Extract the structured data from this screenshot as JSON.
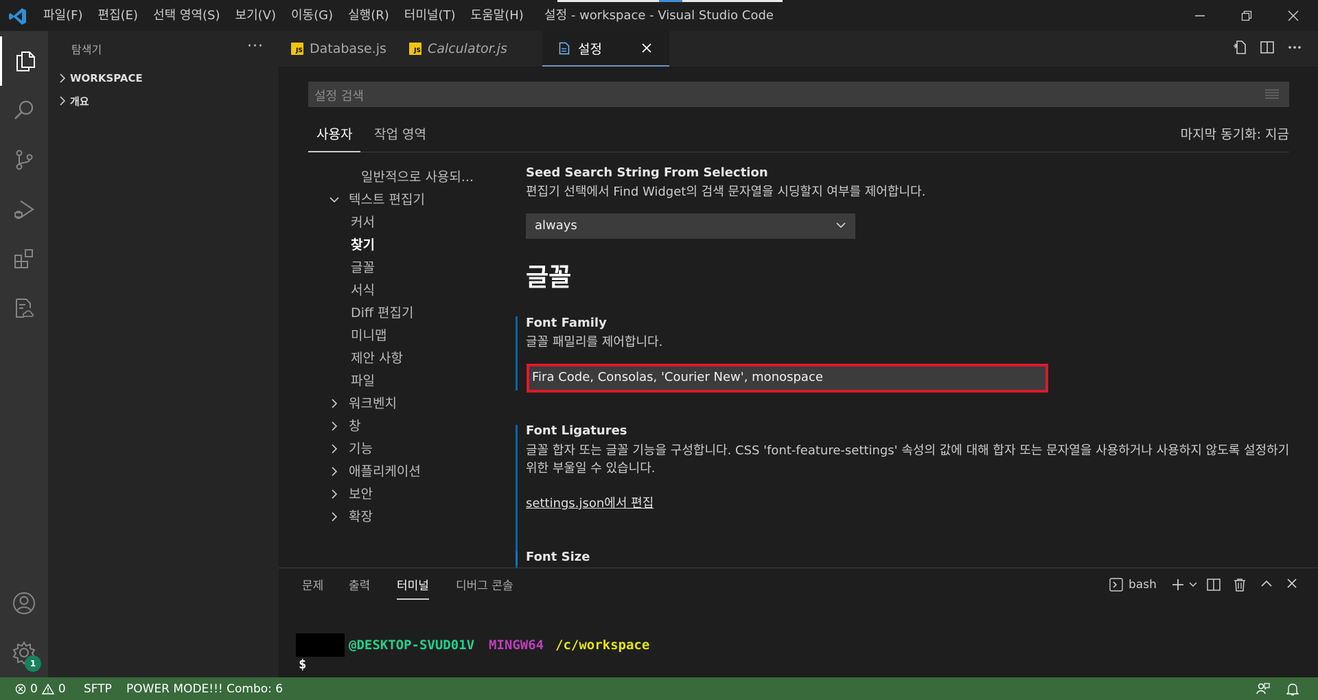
{
  "window": {
    "title": "설정 - workspace - Visual Studio Code",
    "menu": [
      "파일(F)",
      "편집(E)",
      "선택 영역(S)",
      "보기(V)",
      "이동(G)",
      "실행(R)",
      "터미널(T)",
      "도움말(H)"
    ]
  },
  "sidebar": {
    "title": "탐색기",
    "more": "···",
    "sections": [
      "WORKSPACE",
      "개요"
    ]
  },
  "activity": {
    "settings_badge": "1"
  },
  "tabs": [
    {
      "label": "Database.js",
      "badge": "JS"
    },
    {
      "label": "Calculator.js",
      "badge": "JS"
    },
    {
      "label": "설정"
    }
  ],
  "settings": {
    "search_placeholder": "설정 검색",
    "scopes": [
      "사용자",
      "작업 영역"
    ],
    "sync_status": "마지막 동기화: 지금",
    "toc": {
      "common": "일반적으로 사용되...",
      "text_editor": "텍스트 편집기",
      "children": [
        "커서",
        "찾기",
        "글꼴",
        "서식",
        "Diff 편집기",
        "미니맵",
        "제안 사항",
        "파일"
      ],
      "collapsed": [
        "워크벤치",
        "창",
        "기능",
        "애플리케이션",
        "보안",
        "확장"
      ]
    },
    "seed": {
      "title": "Seed Search String From Selection",
      "desc": "편집기 선택에서 Find Widget의 검색 문자열을 시딩할지 여부를 제어합니다.",
      "value": "always"
    },
    "section_heading": "글꼴",
    "font_family": {
      "title": "Font Family",
      "desc": "글꼴 패밀리를 제어합니다.",
      "value": "Fira Code, Consolas, 'Courier New', monospace"
    },
    "font_ligatures": {
      "title": "Font Ligatures",
      "desc": "글꼴 합자 또는 글꼴 기능을 구성합니다. CSS 'font-feature-settings' 속성의 값에 대해 합자 또는 문자열을 사용하거나 사용하지 않도록 설정하기 위한 부울일 수 있습니다.",
      "link": "settings.json에서 편집"
    },
    "font_size": {
      "title": "Font Size"
    }
  },
  "panel": {
    "tabs": [
      "문제",
      "출력",
      "터미널",
      "디버그 콘솔"
    ],
    "shell": "bash",
    "terminal": {
      "host": "@DESKTOP-SVUD01V",
      "env": "MINGW64",
      "path": "/c/workspace",
      "prompt": "$"
    }
  },
  "status": {
    "errors": "0",
    "warnings": "0",
    "sftp": "SFTP",
    "power_mode": "POWER MODE!!! Combo: 6"
  },
  "colors": {
    "statusbar": "#386a3c",
    "highlight": "#e0182a",
    "terminal_host": "#23d18b",
    "terminal_env": "#bc3fbc",
    "terminal_path": "#e5e510"
  }
}
